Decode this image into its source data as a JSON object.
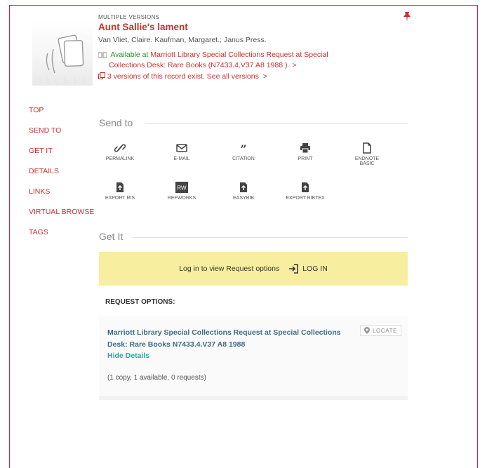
{
  "record": {
    "label": "MULTIPLE VERSIONS",
    "title": "Aunt Sallie's lament",
    "authors": "Van Vliet, Claire. Kaufman, Margaret.; Janus Press.",
    "availability_status": "Available at",
    "availability_location": "Marriott Library Special Collections  Request at Special",
    "availability_location2": "Collections Desk: Rare Books (N7433.4.V37 A8 1988 )",
    "availability_arrow": ">",
    "versions_text": "3 versions of this record exist. See all versions",
    "versions_arrow": ">"
  },
  "nav": {
    "items": [
      "TOP",
      "SEND TO",
      "GET IT",
      "DETAILS",
      "LINKS",
      "VIRTUAL BROWSE",
      "TAGS"
    ]
  },
  "send_to": {
    "heading": "Send to",
    "actions": [
      {
        "label": "PERMALINK",
        "icon": "link-icon"
      },
      {
        "label": "E-MAIL",
        "icon": "envelope-icon"
      },
      {
        "label": "CITATION",
        "icon": "quote-icon"
      },
      {
        "label": "PRINT",
        "icon": "printer-icon"
      },
      {
        "label": "ENDNOTE",
        "label2": "BASIC",
        "icon": "document-icon"
      },
      {
        "label": "EXPORT RIS",
        "icon": "export-file-icon"
      },
      {
        "label": "REFWORKS",
        "icon": "refworks-icon",
        "badge": "RW"
      },
      {
        "label": "EASYBIB",
        "icon": "easybib-icon"
      },
      {
        "label": "EXPORT BIBTEX",
        "icon": "export-file-icon"
      }
    ]
  },
  "get_it": {
    "heading": "Get It",
    "login_prompt": "Log in to view Request options",
    "login_label": "LOG IN",
    "request_options_heading": "REQUEST OPTIONS:",
    "request_location_line1": "Marriott Library Special Collections  Request at Special Collections",
    "request_location_line2": "Desk: Rare Books  N7433.4.V37 A8 1988",
    "hide_details": "Hide Details",
    "copies": "(1 copy, 1 available, 0 requests)",
    "locate_label": "LOCATE"
  },
  "colors": {
    "accent": "#c9302c",
    "frame": "#d0214e",
    "available": "#2d8a2d",
    "login_bg": "#f7ef9f",
    "link_blue": "#3d6b8a",
    "teal": "#2aa6a6"
  }
}
